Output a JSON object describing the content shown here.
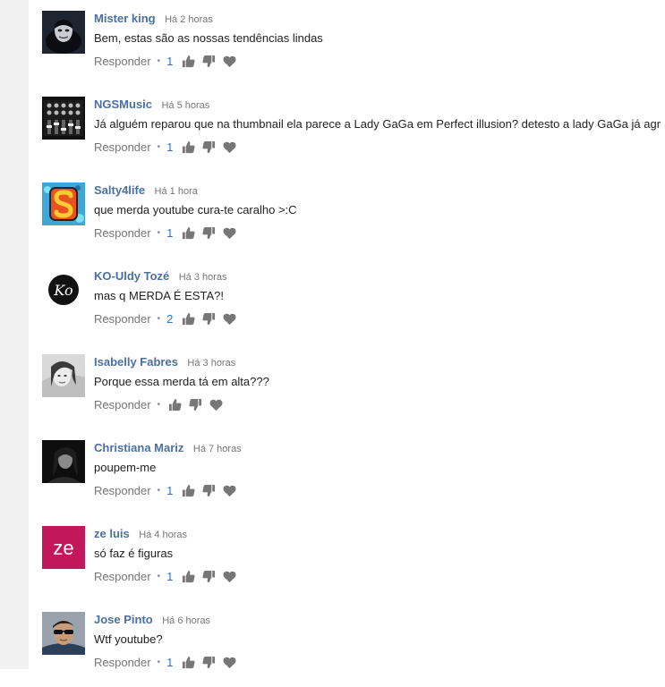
{
  "comments": [
    {
      "author": "Mister king",
      "time": "Há 2 horas",
      "text": "Bem, estas são as nossas tendências lindas",
      "reply": "Responder",
      "likes": "1",
      "avatar": "masked-person"
    },
    {
      "author": "NGSMusic",
      "time": "Há 5 horas",
      "text": "Já alguém reparou que na thumbnail ela parece a Lady GaGa em Perfect illusion? detesto a lady GaGa já agr",
      "reply": "Responder",
      "likes": "1",
      "avatar": "mixing-console"
    },
    {
      "author": "Salty4life",
      "time": "Há 1 hora",
      "text": "que merda youtube cura-te caralho >:C",
      "reply": "Responder",
      "likes": "1",
      "avatar": "s-logo"
    },
    {
      "author": "KO-Uldy Tozé",
      "time": "Há 3 horas",
      "text": "mas q MERDA É ESTA?!",
      "reply": "Responder",
      "likes": "2",
      "avatar": "ko-logo",
      "avatar_text": "Ko"
    },
    {
      "author": "Isabelly Fabres",
      "time": "Há 3 horas",
      "text": "Porque essa merda tá em alta???",
      "reply": "Responder",
      "likes": "",
      "avatar": "person-photo"
    },
    {
      "author": "Christiana Mariz",
      "time": "Há 7 horas",
      "text": "poupem-me",
      "reply": "Responder",
      "likes": "1",
      "avatar": "person-dark-photo"
    },
    {
      "author": "ze luis",
      "time": "Há 4 horas",
      "text": "só faz é figuras",
      "reply": "Responder",
      "likes": "1",
      "avatar": "letter-avatar",
      "avatar_text": "ze",
      "avatar_color": "#c2185b"
    },
    {
      "author": "Jose Pinto",
      "time": "Há 6 horas",
      "text": "Wtf youtube?",
      "reply": "Responder",
      "likes": "1",
      "avatar": "person-sunglasses"
    }
  ]
}
